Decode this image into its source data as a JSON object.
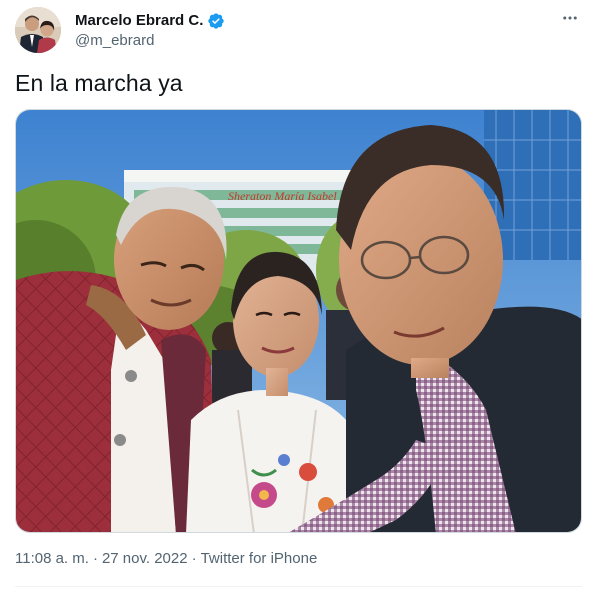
{
  "author": {
    "display_name": "Marcelo Ebrard C.",
    "handle": "@m_ebrard",
    "verified": true,
    "verified_color": "#1d9bf0"
  },
  "tweet": {
    "text": "En la marcha ya"
  },
  "media": {
    "type": "photo",
    "sign_text": "Sheraton María Isabel"
  },
  "meta": {
    "time": "11:08 a. m.",
    "separator": "·",
    "date": "27 nov. 2022",
    "source": "Twitter for iPhone"
  },
  "icons": {
    "more": "more-horizontal-icon",
    "verified": "verified-badge-icon"
  },
  "colors": {
    "text_primary": "#0f1419",
    "text_secondary": "#536471",
    "border": "#cfd9de"
  }
}
